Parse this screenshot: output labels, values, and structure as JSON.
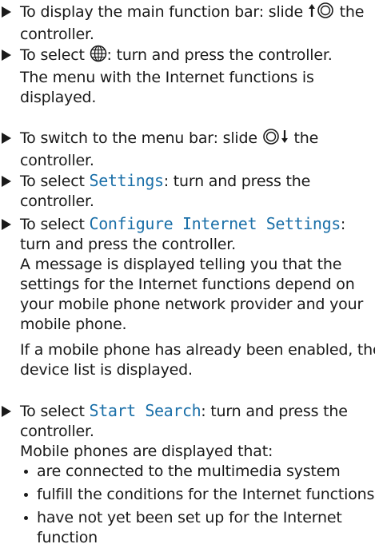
{
  "steps": [
    {
      "pre": "To display the main function bar: slide ",
      "post": " the controller."
    },
    {
      "pre": "To select ",
      "post": ": turn and press the controller.",
      "result": "The menu with the Internet functions is displayed."
    },
    {
      "pre": "To switch to the menu bar: slide ",
      "post": " the controller."
    },
    {
      "pre": "To select ",
      "item": "Settings",
      "post": ": turn and press the controller."
    },
    {
      "pre": "To select ",
      "item": "Configure Internet Settings",
      "post": ":",
      "line2": "turn and press the controller.",
      "result": "A message is displayed telling you that the settings for the Internet functions depend on your mobile phone network provider and your mobile phone.",
      "note": "If a mobile phone has already been enabled, the device list is displayed."
    },
    {
      "pre": "To select ",
      "item": "Start Search",
      "post": ": turn and press the controller.",
      "result": "Mobile phones are displayed that:",
      "bullets": [
        "are connected to the multimedia system",
        "fulfill the conditions for the Internet functions",
        "have not yet been set up for the Internet function"
      ]
    }
  ],
  "icons": {
    "slide_up": "slide-up-controller-icon",
    "globe": "internet-globe-icon",
    "slide_down": "slide-down-controller-icon"
  },
  "colors": {
    "text": "#1a1a1a",
    "display_text": "#1a6fa8"
  }
}
